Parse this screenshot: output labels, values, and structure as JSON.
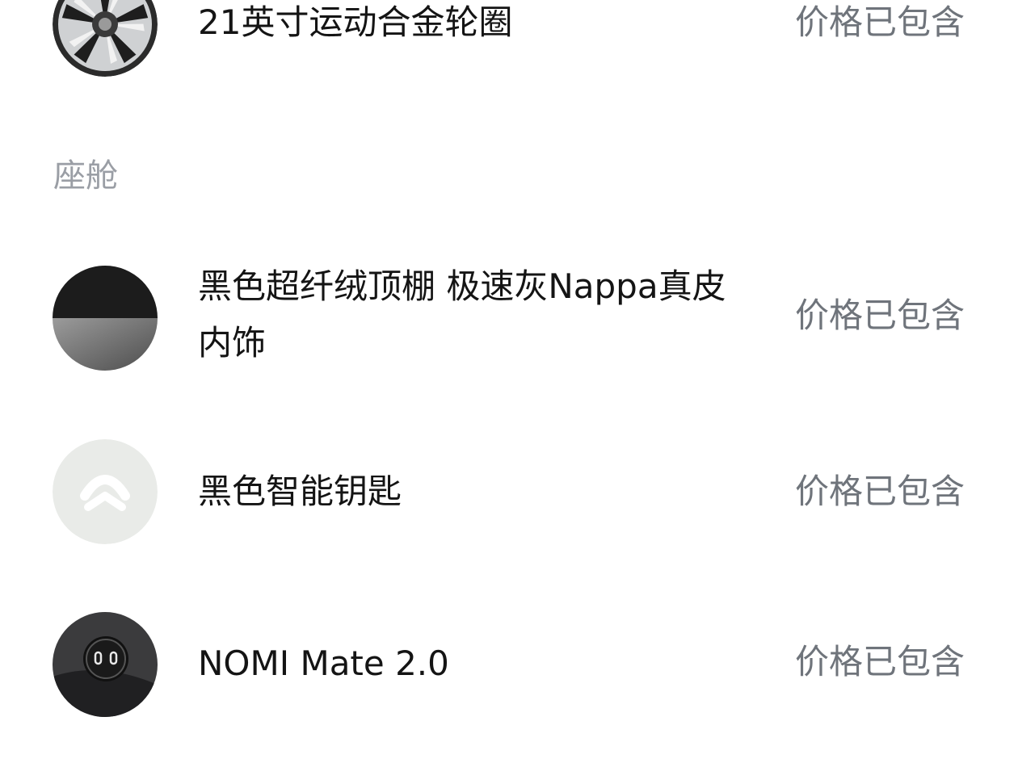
{
  "sections": {
    "cabin_title": "座舱"
  },
  "items": [
    {
      "name": "21英寸运动合金轮圈",
      "price_note": "价格已包含",
      "icon": "alloy-wheel-icon"
    },
    {
      "name": "黑色超纤绒顶棚 极速灰Nappa真皮内饰",
      "price_note": "价格已包含",
      "icon": "interior-swatch-icon"
    },
    {
      "name": "黑色智能钥匙",
      "price_note": "价格已包含",
      "icon": "nio-key-icon"
    },
    {
      "name": "NOMI Mate 2.0",
      "price_note": "价格已包含",
      "icon": "nomi-mate-icon"
    }
  ],
  "colors": {
    "text_primary": "#141414",
    "text_secondary": "#6f747b",
    "section_title": "#9a9ea5",
    "key_background": "#e9ebe8"
  }
}
